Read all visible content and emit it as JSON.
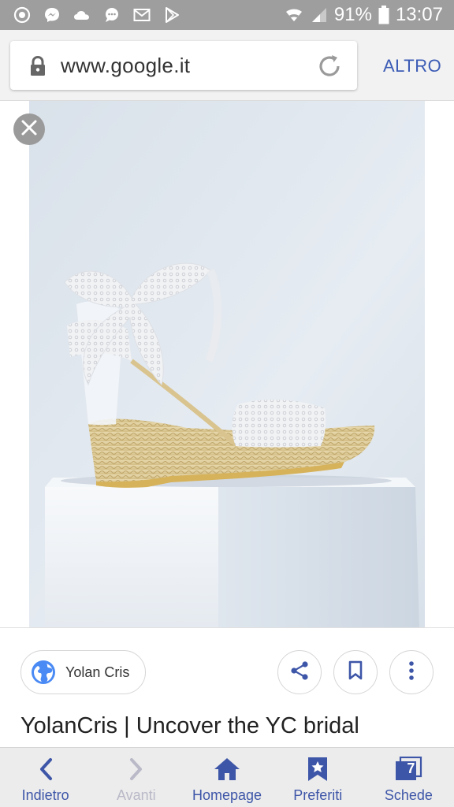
{
  "status_bar": {
    "battery": "91%",
    "time": "13:07",
    "notification_icons": [
      "whatsapp-icon",
      "messenger-icon",
      "weather-icon",
      "chat-icon",
      "mail-icon",
      "play-store-icon"
    ],
    "system_icons": [
      "wifi-icon",
      "signal-icon",
      "battery-icon"
    ]
  },
  "browser": {
    "url": "www.google.it",
    "more_label": "ALTRO"
  },
  "image_viewer": {
    "image_subject": "white lace espadrille wedge sandal on pedestal"
  },
  "result": {
    "source_label": "Yolan Cris",
    "title": "YolanCris | Uncover the YC bridal"
  },
  "bottom_nav": {
    "back": "Indietro",
    "forward": "Avanti",
    "home": "Homepage",
    "bookmarks": "Preferiti",
    "tabs": "Schede",
    "tab_count": "7"
  },
  "colors": {
    "accent": "#3e56a8",
    "status_bar": "#9e9e9e",
    "nav_background": "#ececec"
  }
}
